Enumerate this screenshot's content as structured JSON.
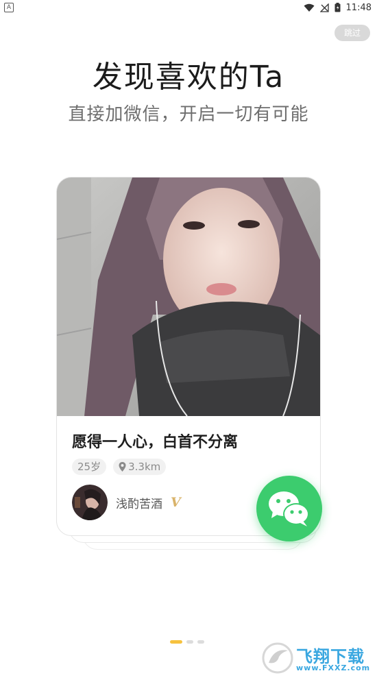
{
  "status_bar": {
    "left_icon_text": "A",
    "time": "11:48"
  },
  "skip_button": "跳过",
  "title": "发现喜欢的Ta",
  "subtitle": "直接加微信，开启一切有可能",
  "card": {
    "text": "愿得一人心，白首不分离",
    "tags": {
      "age": "25岁",
      "distance": "3.3km"
    },
    "username": "浅酌苦酒",
    "vip_badge": "V"
  },
  "watermark": {
    "text": "飞翔下载",
    "url": "www.FXXZ.com"
  },
  "colors": {
    "accent": "#3ccc6e",
    "dot_active": "#f6c23e",
    "vip": "#d9b36a"
  }
}
